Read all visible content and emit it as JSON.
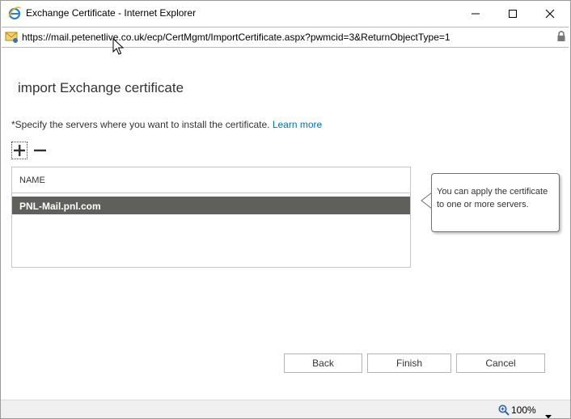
{
  "window": {
    "title": "Exchange Certificate - Internet Explorer",
    "icons": {
      "app": "internet-explorer-icon",
      "minimize": "minimize-icon",
      "maximize": "maximize-icon",
      "close": "close-icon"
    }
  },
  "address_bar": {
    "url": "https://mail.petenetlive.co.uk/ecp/CertMgmt/ImportCertificate.aspx?pwmcid=3&ReturnObjectType=1",
    "icons": {
      "page": "envelope-page-icon",
      "secure": "lock-icon"
    }
  },
  "page": {
    "title": "import Exchange certificate",
    "instruction": "*Specify the servers where you want to install the certificate.",
    "learn_more": "Learn more"
  },
  "toolbar": {
    "add_icon": "plus-icon",
    "remove_icon": "minus-icon"
  },
  "servers_table": {
    "column_header": "NAME",
    "rows": [
      {
        "name": "PNL-Mail.pnl.com",
        "selected": true
      }
    ]
  },
  "callout": {
    "text": "You can apply the certificate to one or more servers."
  },
  "footer": {
    "back_label": "Back",
    "finish_label": "Finish",
    "cancel_label": "Cancel"
  },
  "status_bar": {
    "zoom": "100%",
    "zoom_icon": "zoom-icon"
  },
  "colors": {
    "link": "#0072c6",
    "selected_row": "#5f605b",
    "ie_blue": "#1e88e5"
  }
}
